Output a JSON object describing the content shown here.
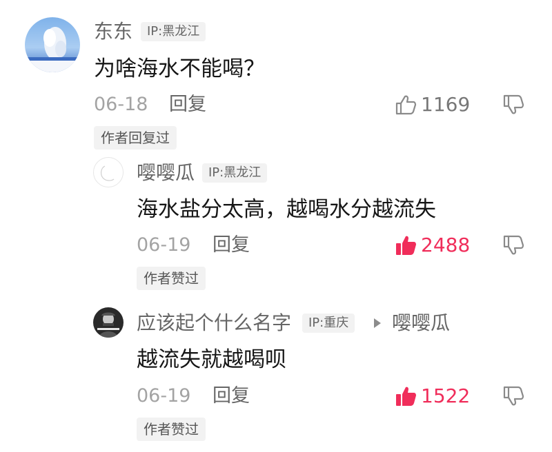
{
  "comments": [
    {
      "username": "东东",
      "ip": "IP:黑龙江",
      "text": "为啥海水不能喝？",
      "date": "06-18",
      "reply_label": "回复",
      "likes": "1169",
      "liked": false,
      "tag": "作者回复过"
    },
    {
      "username": "嘤嘤瓜",
      "ip": "IP:黑龙江",
      "text": "海水盐分太高，越喝水分越流失",
      "date": "06-19",
      "reply_label": "回复",
      "likes": "2488",
      "liked": true,
      "tag": "作者赞过"
    },
    {
      "username": "应该起个什么名字",
      "ip": "IP:重庆",
      "reply_to": "嘤嘤瓜",
      "text": "越流失就越喝呗",
      "date": "06-19",
      "reply_label": "回复",
      "likes": "1522",
      "liked": true,
      "tag": "作者赞过"
    }
  ],
  "colors": {
    "like_active": "#f02d5a",
    "text_primary": "#161616",
    "text_secondary": "#666666",
    "chip_bg": "#f2f2f2"
  },
  "icons": {
    "like": "thumbs-up-icon",
    "dislike": "thumbs-down-icon",
    "reply_arrow": "play-arrow-icon"
  }
}
